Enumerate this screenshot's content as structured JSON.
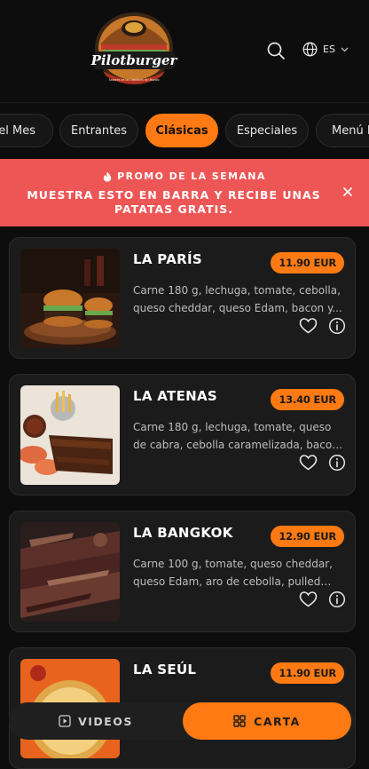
{
  "header": {
    "logo_text": "Pilotburger",
    "logo_tagline": "Sabores de las Capitales del Mundo",
    "language": "ES"
  },
  "tabs": [
    {
      "label": "del Mes",
      "active": false
    },
    {
      "label": "Entrantes",
      "active": false
    },
    {
      "label": "Clásicas",
      "active": true
    },
    {
      "label": "Especiales",
      "active": false
    },
    {
      "label": "Menú In",
      "active": false
    }
  ],
  "promo": {
    "title": "PROMO DE LA SEMANA",
    "text": "MUESTRA ESTO EN BARRA Y RECIBE UNAS PATATAS GRATIS."
  },
  "items": [
    {
      "name": "LA PARÍS",
      "price": "11.90 EUR",
      "description": "Carne 180 g, lechuga, tomate, cebolla, queso cheddar, queso Edam, bacon y..."
    },
    {
      "name": "LA ATENAS",
      "price": "13.40 EUR",
      "description": "Carne 180 g, lechuga, tomate, queso de cabra, cebolla caramelizada, bacon y..."
    },
    {
      "name": "LA BANGKOK",
      "price": "12.90 EUR",
      "description": "Carne 100 g, tomate, queso cheddar, queso Edam, aro de cebolla, pulled por..."
    },
    {
      "name": "LA SEÚL",
      "price": "11.90 EUR",
      "description": ""
    }
  ],
  "bottom": {
    "videos_label": "VIDEOS",
    "carta_label": "CARTA"
  },
  "colors": {
    "accent": "#ff7a12",
    "promo_bg": "#ee5656",
    "background": "#0d0d0d",
    "card": "#1b1b1b"
  }
}
